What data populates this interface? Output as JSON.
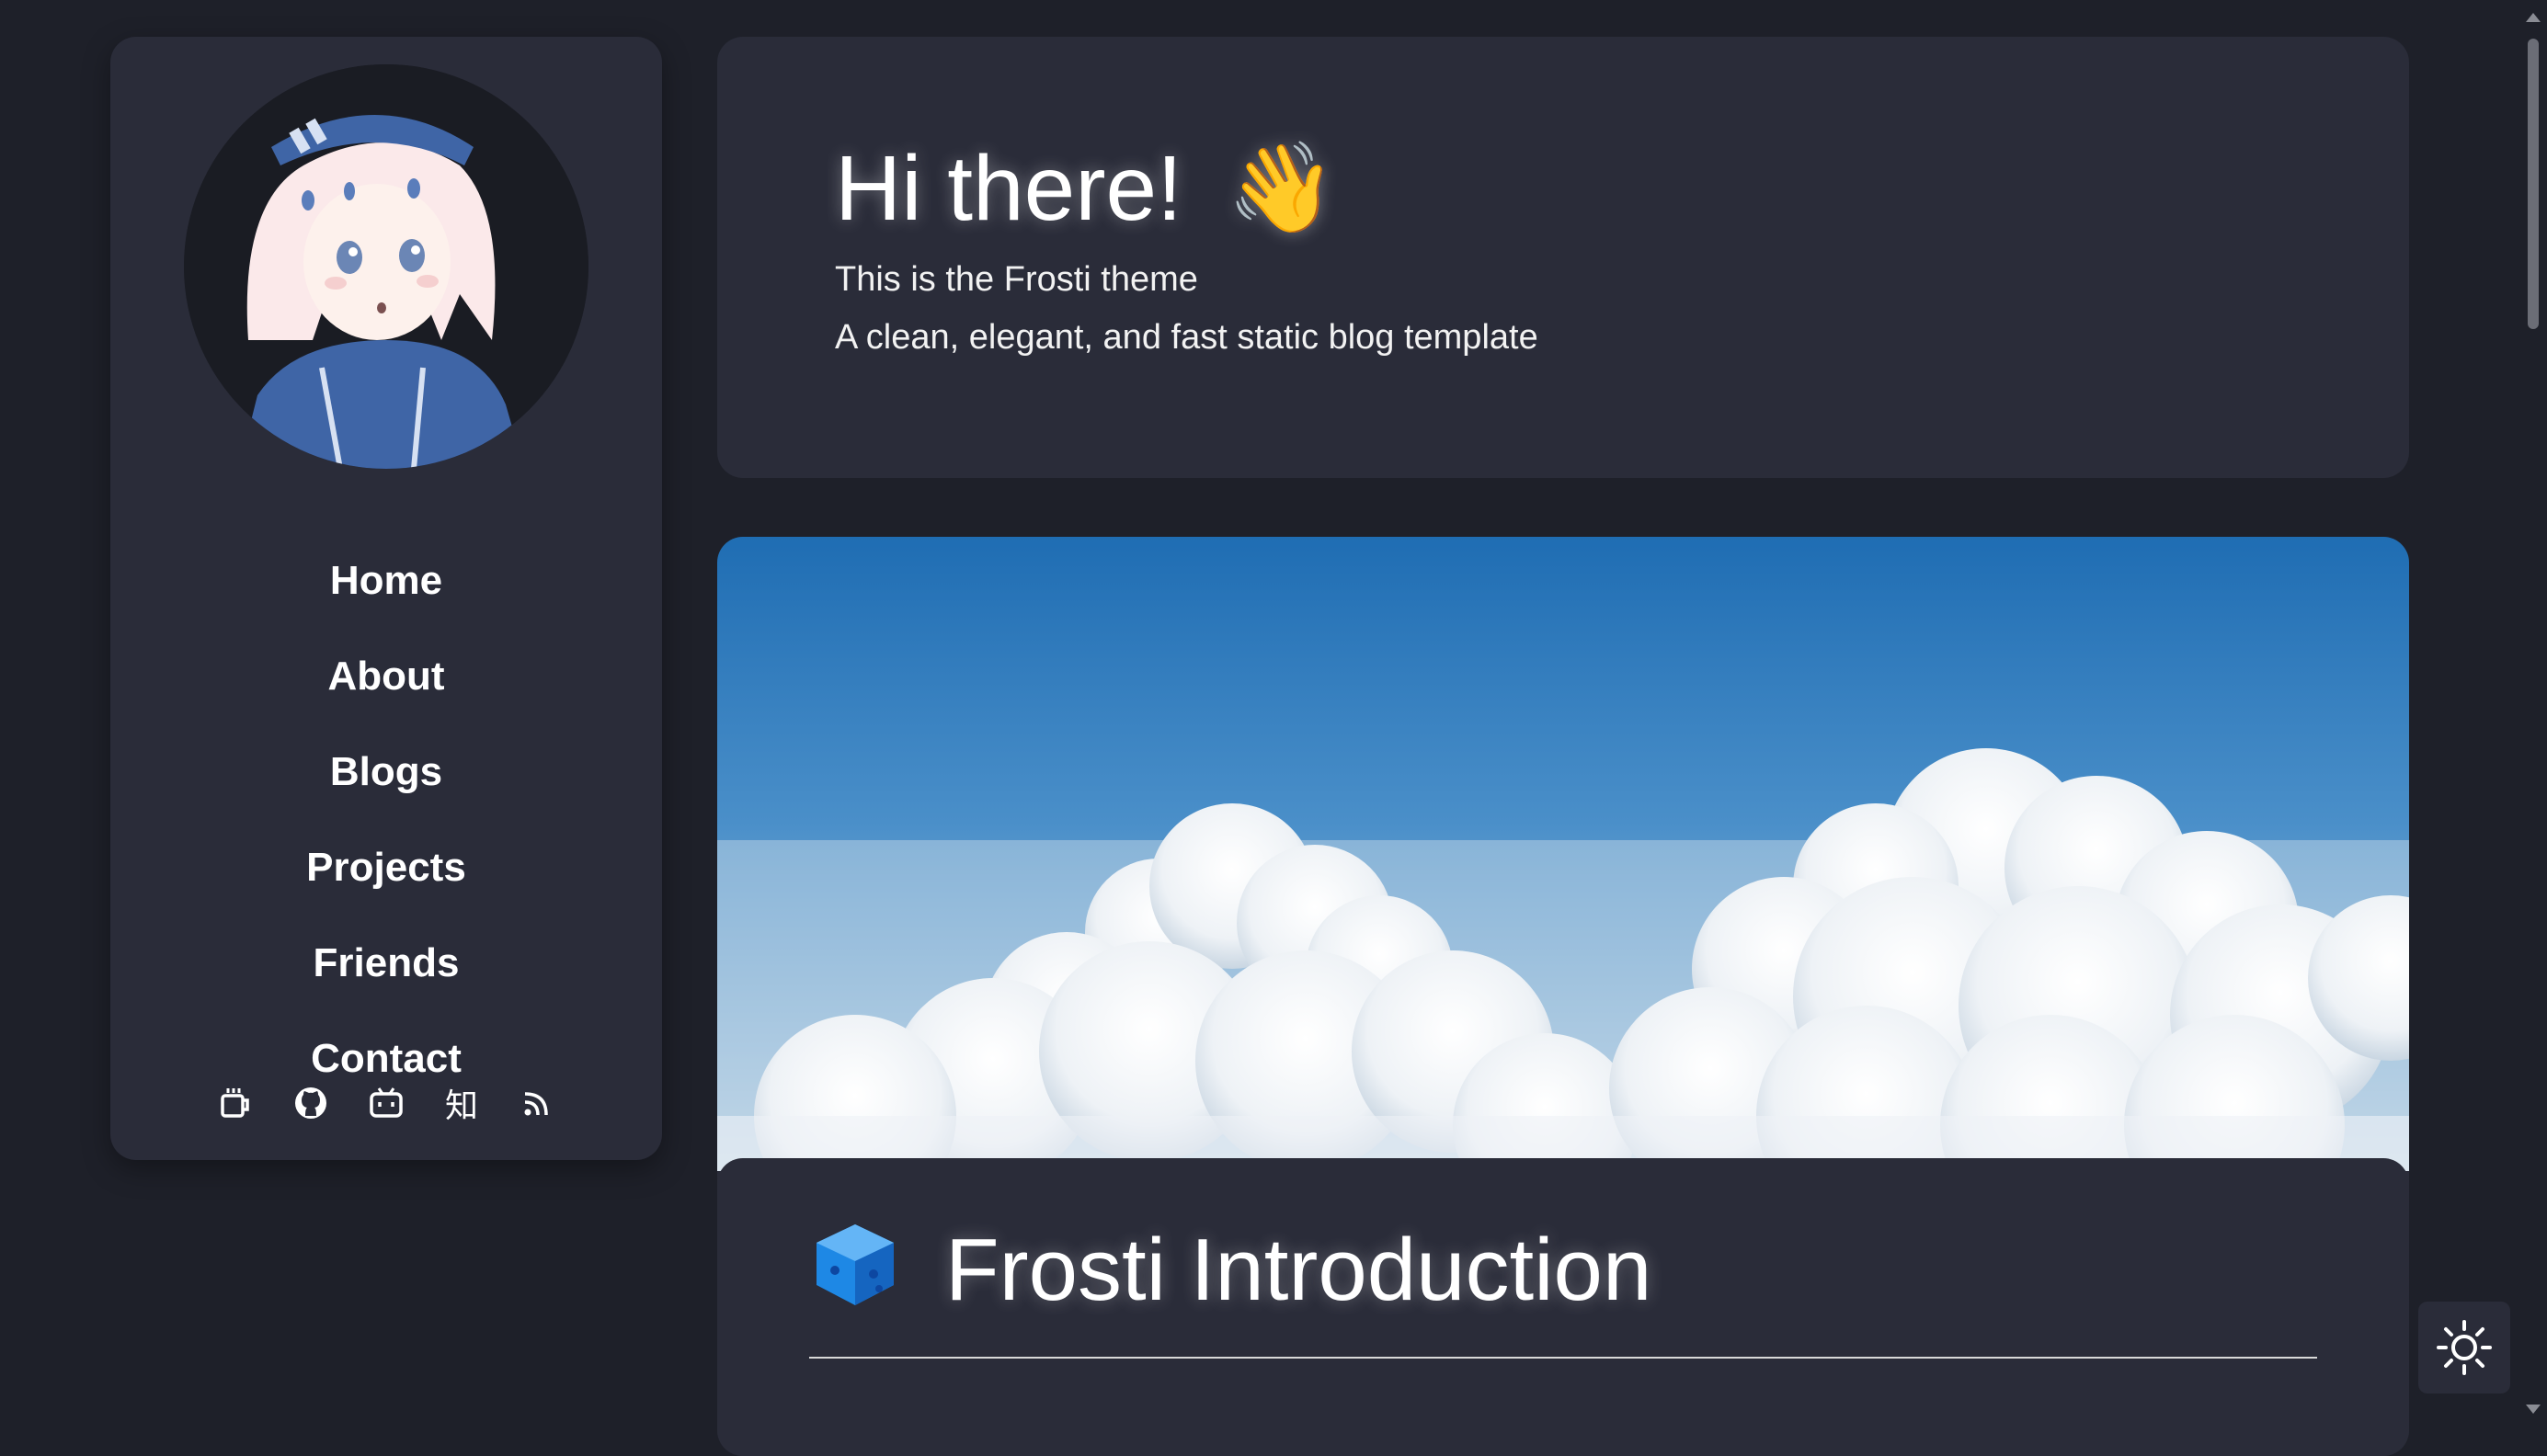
{
  "sidebar": {
    "nav": [
      {
        "label": "Home"
      },
      {
        "label": "About"
      },
      {
        "label": "Blogs"
      },
      {
        "label": "Projects"
      },
      {
        "label": "Friends"
      },
      {
        "label": "Contact"
      }
    ],
    "socials": [
      {
        "icon": "coffee-cup-icon"
      },
      {
        "icon": "github-icon"
      },
      {
        "icon": "bilibili-icon"
      },
      {
        "icon": "zhihu-icon",
        "glyph": "知"
      },
      {
        "icon": "rss-icon"
      }
    ]
  },
  "hero": {
    "title": "Hi there!",
    "emoji": "👋",
    "line1": "This is the Frosti theme",
    "line2": "A clean, elegant, and fast static blog template"
  },
  "post": {
    "title": "Frosti Introduction"
  },
  "theme_toggle": {
    "icon": "sun-icon"
  },
  "colors": {
    "page_bg": "#1e2029",
    "card_bg": "#2a2c39",
    "text": "#ffffff",
    "sky_top": "#1f6db3",
    "sky_bottom": "#b9d2e6"
  }
}
